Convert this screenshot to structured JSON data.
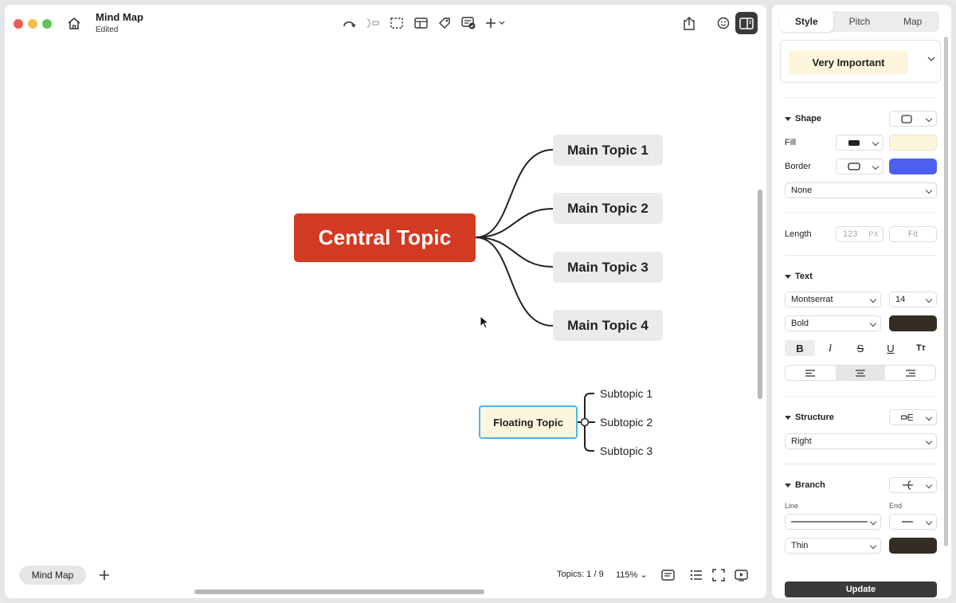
{
  "app": {
    "title": "Mind Map",
    "status": "Edited"
  },
  "toolbar": {
    "icons": [
      "undo-icon",
      "relationship-icon",
      "boundary-icon",
      "summary-icon",
      "label-icon",
      "task-icon",
      "add-icon"
    ]
  },
  "map": {
    "central": "Central Topic",
    "main_topics": [
      "Main Topic 1",
      "Main Topic 2",
      "Main Topic 3",
      "Main Topic 4"
    ],
    "floating": "Floating Topic",
    "subtopics": [
      "Subtopic 1",
      "Subtopic 2",
      "Subtopic 3"
    ]
  },
  "bottom": {
    "sheet_tab": "Mind Map",
    "topics_count": "Topics: 1 / 9",
    "zoom": "115%"
  },
  "panel": {
    "tabs": [
      "Style",
      "Pitch",
      "Map"
    ],
    "active_tab": "Style",
    "preset": "Very Important",
    "shape": {
      "heading": "Shape",
      "fill_label": "Fill",
      "border_label": "Border",
      "border_style": "None",
      "fill_color": "#fdf6dd",
      "border_color": "#4c5ff0"
    },
    "length": {
      "label": "Length",
      "placeholder": "123",
      "unit": "PX",
      "fit": "Fit"
    },
    "text": {
      "heading": "Text",
      "font": "Montserrat",
      "size": "14",
      "weight": "Bold",
      "color": "#332d24",
      "format_buttons": [
        "B",
        "I",
        "S",
        "U",
        "Tт"
      ]
    },
    "structure": {
      "heading": "Structure",
      "value": "Right"
    },
    "branch": {
      "heading": "Branch",
      "line_label": "Line",
      "end_label": "End",
      "thickness": "Thin",
      "color": "#332d24"
    },
    "update": "Update"
  },
  "colors": {
    "central": "#d33a22",
    "main_topic_bg": "#ebebed",
    "floating_bg": "#fdf6dd",
    "floating_border": "#4fb3ec"
  }
}
